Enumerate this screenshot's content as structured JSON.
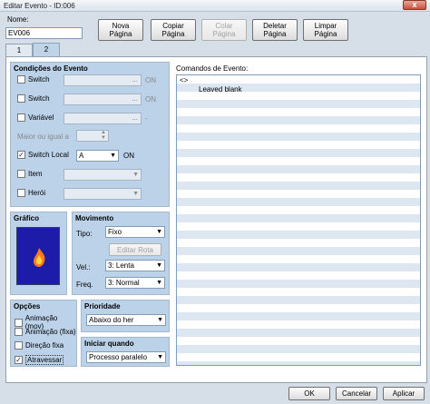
{
  "window": {
    "title": "Editar Evento - ID:006",
    "close_glyph": "x"
  },
  "header": {
    "name_label": "Nome:",
    "name_value": "EV006",
    "buttons": {
      "new_page": [
        "Nova",
        "Página"
      ],
      "copy_page": [
        "Copiar",
        "Página"
      ],
      "paste_page": [
        "Colar",
        "Página"
      ],
      "delete_page": [
        "Deletar",
        "Página"
      ],
      "clear_page": [
        "Limpar",
        "Página"
      ]
    }
  },
  "tabs": [
    {
      "label": "1",
      "active": false
    },
    {
      "label": "2",
      "active": true
    }
  ],
  "conditions": {
    "title": "Condições do Evento",
    "switch1": {
      "label": "Switch",
      "value": "",
      "dots": "...",
      "suffix": "ON"
    },
    "switch2": {
      "label": "Switch",
      "value": "",
      "dots": "...",
      "suffix": "ON"
    },
    "variable": {
      "label": "Variável",
      "value": "",
      "dots": "...",
      "suffix": "-"
    },
    "greater_equal": {
      "label": "Maior ou igual a",
      "value": ""
    },
    "self_switch": {
      "label": "Switch Local",
      "value": "A",
      "suffix": "ON",
      "checked": true
    },
    "item": {
      "label": "Item",
      "value": ""
    },
    "hero": {
      "label": "Herói",
      "value": ""
    }
  },
  "graphic": {
    "title": "Gráfico",
    "icon": "flame-icon"
  },
  "movement": {
    "title": "Movimento",
    "type_label": "Tipo:",
    "type_value": "Fixo",
    "edit_route": "Editar Rota",
    "speed_label": "Vel.:",
    "speed_value": "3: Lenta",
    "freq_label": "Freq.",
    "freq_value": "3: Normal"
  },
  "options": {
    "title": "Opções",
    "items": [
      {
        "label": "Animação (mov)",
        "checked": false
      },
      {
        "label": "Animação (fixa)",
        "checked": false
      },
      {
        "label": "Direção fixa",
        "checked": false
      },
      {
        "label": "Atravessar",
        "checked": true
      }
    ]
  },
  "priority": {
    "title": "Prioridade",
    "value": "Abaixo do her"
  },
  "trigger": {
    "title": "Iniciar quando",
    "value": "Processo paralelo"
  },
  "commands": {
    "title": "Comandos de Evento:",
    "lines": [
      "<>",
      "Leaved blank"
    ]
  },
  "footer": {
    "ok": "OK",
    "cancel": "Cancelar",
    "apply": "Aplicar"
  },
  "colors": {
    "accent": "#bcd2e8",
    "fire": "#ff7a1a",
    "fire_bg": "#1c1ca8"
  }
}
